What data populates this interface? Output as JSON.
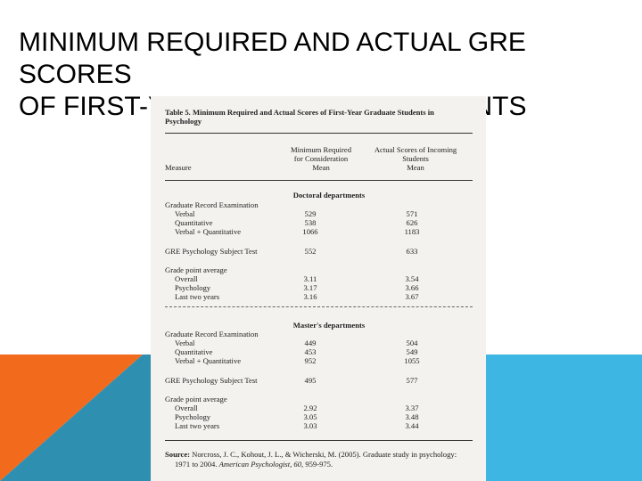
{
  "slide": {
    "title_line1": "Minimum Required and Actual GRE Scores",
    "title_line2": "of First-Year Graduate Students",
    "colors": {
      "orange": "#f26a1b",
      "teal": "#2e8fb0",
      "sky": "#3db6e3"
    }
  },
  "table": {
    "caption_line1": "Table 5.  Minimum Required and Actual Scores of First-Year Graduate Students in",
    "caption_line2": "Psychology",
    "headers": {
      "measure": "Measure",
      "min_line1": "Minimum Required",
      "min_line2": "for Consideration",
      "min_line3": "Mean",
      "act_line1": "Actual Scores of Incoming",
      "act_line2": "Students",
      "act_line3": "Mean"
    },
    "sections": [
      {
        "heading": "Doctoral departments",
        "gre_label": "Graduate Record Examination",
        "rows_gre": [
          {
            "label": "Verbal",
            "min": "529",
            "act": "571"
          },
          {
            "label": "Quantitative",
            "min": "538",
            "act": "626"
          },
          {
            "label": "Verbal + Quantitative",
            "min": "1066",
            "act": "1183"
          }
        ],
        "subject": {
          "label": "GRE Psychology Subject Test",
          "min": "552",
          "act": "633"
        },
        "gpa_label": "Grade point average",
        "rows_gpa": [
          {
            "label": "Overall",
            "min": "3.11",
            "act": "3.54"
          },
          {
            "label": "Psychology",
            "min": "3.17",
            "act": "3.66"
          },
          {
            "label": "Last two years",
            "min": "3.16",
            "act": "3.67"
          }
        ]
      },
      {
        "heading": "Master's departments",
        "gre_label": "Graduate Record Examination",
        "rows_gre": [
          {
            "label": "Verbal",
            "min": "449",
            "act": "504"
          },
          {
            "label": "Quantitative",
            "min": "453",
            "act": "549"
          },
          {
            "label": "Verbal + Quantitative",
            "min": "952",
            "act": "1055"
          }
        ],
        "subject": {
          "label": "GRE Psychology Subject Test",
          "min": "495",
          "act": "577"
        },
        "gpa_label": "Grade point average",
        "rows_gpa": [
          {
            "label": "Overall",
            "min": "2.92",
            "act": "3.37"
          },
          {
            "label": "Psychology",
            "min": "3.05",
            "act": "3.48"
          },
          {
            "label": "Last two years",
            "min": "3.03",
            "act": "3.44"
          }
        ]
      }
    ],
    "source": {
      "label": "Source:",
      "text1": "Norcross, J. C., Kohout, J. L., & Wicherski, M. (2005). Graduate study in psychology:",
      "text2a": "1971 to 2004. ",
      "journal": "American Psychologist, 60,",
      "text2b": " 959-975."
    }
  }
}
